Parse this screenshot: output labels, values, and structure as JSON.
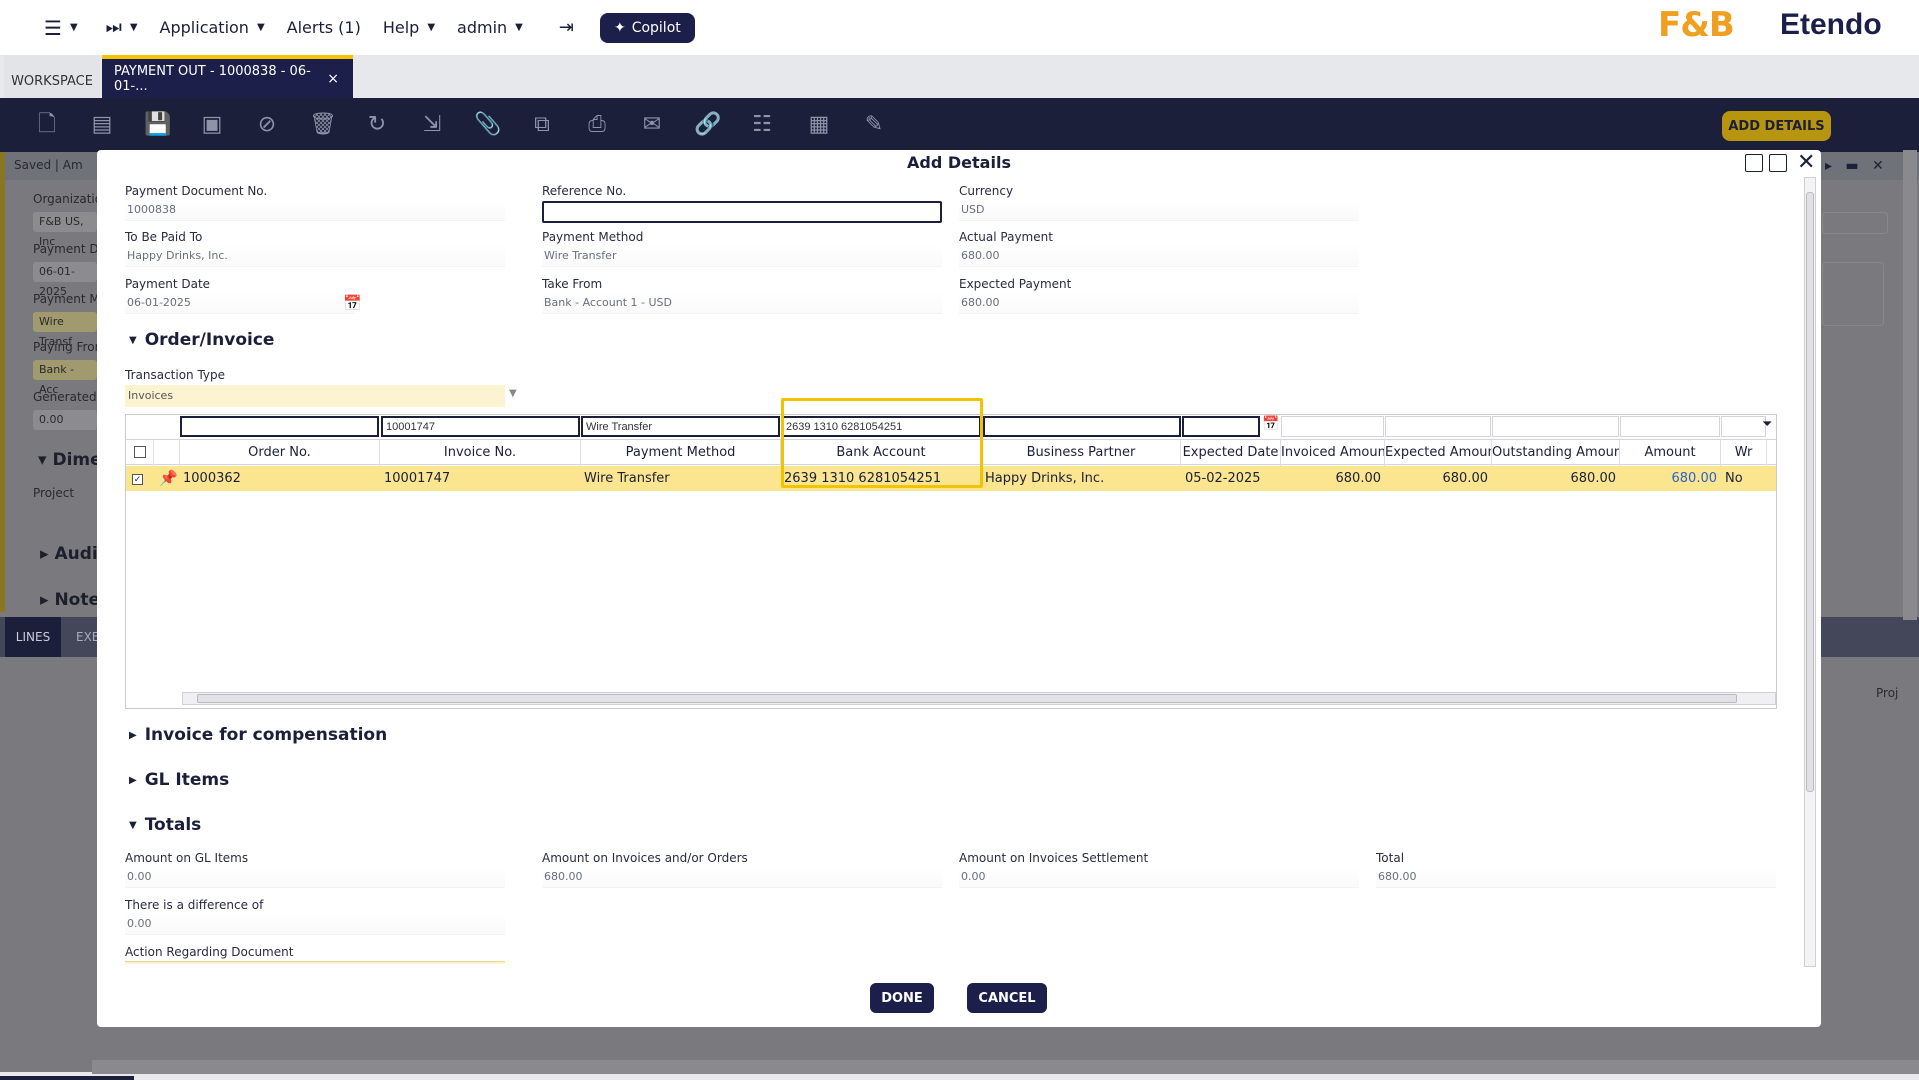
{
  "topnav": {
    "items": [
      "Application",
      "Alerts (1)",
      "Help",
      "admin"
    ],
    "copilot_label": "Copilot",
    "brand_left": "F&B",
    "brand_right": "Etendo"
  },
  "tabs": {
    "workspace": "WORKSPACE",
    "active": "PAYMENT OUT - 1000838 - 06-01-...",
    "close": "×"
  },
  "toolbar": {
    "add_details_label": "ADD DETAILS",
    "icons": [
      "new-document-icon",
      "new-row-icon",
      "save-icon",
      "save-close-icon",
      "cancel-icon",
      "delete-icon",
      "refresh-icon",
      "export-icon",
      "attach-icon",
      "copy-icon",
      "print-icon",
      "email-icon",
      "link-icon",
      "audit-icon",
      "grid-view-icon",
      "notes-icon"
    ]
  },
  "background": {
    "status": "Saved | Am",
    "org_label": "Organizatio",
    "org_value": "F&B US, Inc",
    "paydoc_label": "Payment Do",
    "paydoc_value": "06-01-2025",
    "paymethod_label": "Payment Me",
    "paymethod_value": "Wire Transf",
    "payfrom_label": "Paying From",
    "payfrom_value": "Bank - Acc",
    "generated_label": "Generated",
    "generated_value": "0.00",
    "dimensions": "Dime",
    "project_label": "Project",
    "audit": "Audit",
    "notes": "Notes",
    "lines_tab": "LINES",
    "exe_tab": "EXE",
    "proj_col": "Proj"
  },
  "modal": {
    "title": "Add Details",
    "fields": {
      "payment_doc_label": "Payment Document No.",
      "payment_doc_value": "1000838",
      "reference_label": "Reference No.",
      "reference_value": "",
      "currency_label": "Currency",
      "currency_value": "USD",
      "paid_to_label": "To Be Paid To",
      "paid_to_value": "Happy Drinks, Inc.",
      "payment_method_label": "Payment Method",
      "payment_method_value": "Wire Transfer",
      "actual_payment_label": "Actual Payment",
      "actual_payment_value": "680.00",
      "payment_date_label": "Payment Date",
      "payment_date_value": "06-01-2025",
      "take_from_label": "Take From",
      "take_from_value": "Bank - Account 1 - USD",
      "expected_payment_label": "Expected Payment",
      "expected_payment_value": "680.00"
    },
    "order_invoice_section": "Order/Invoice",
    "transaction_type_label": "Transaction Type",
    "transaction_type_value": "Invoices",
    "grid": {
      "filters": [
        "",
        "10001747",
        "Wire Transfer",
        "2639 1310 6281054251",
        "",
        "",
        "",
        "",
        "",
        "",
        ""
      ],
      "headers": [
        "Order No.",
        "Invoice No.",
        "Payment Method",
        "Bank Account",
        "Business Partner",
        "Expected Date",
        "Invoiced Amount",
        "Expected Amount",
        "Outstanding Amount",
        "Amount",
        "Wr"
      ],
      "rows": [
        {
          "order_no": "1000362",
          "invoice_no": "10001747",
          "payment_method": "Wire Transfer",
          "bank_account": "2639 1310 6281054251",
          "business_partner": "Happy Drinks, Inc.",
          "expected_date": "05-02-2025",
          "invoiced_amount": "680.00",
          "expected_amount": "680.00",
          "outstanding_amount": "680.00",
          "amount": "680.00",
          "wr": "No"
        }
      ]
    },
    "invoice_compensation_section": "Invoice for compensation",
    "gl_items_section": "GL Items",
    "totals_section": "Totals",
    "totals": {
      "gl_items_label": "Amount on GL Items",
      "gl_items_value": "0.00",
      "invoices_orders_label": "Amount on Invoices and/or Orders",
      "invoices_orders_value": "680.00",
      "settlement_label": "Amount on Invoices Settlement",
      "settlement_value": "0.00",
      "total_label": "Total",
      "total_value": "680.00",
      "difference_label": "There is a difference of",
      "difference_value": "0.00",
      "action_label": "Action Regarding Document"
    },
    "done_label": "DONE",
    "cancel_label": "CANCEL"
  },
  "colors": {
    "navy": "#1b1f4a",
    "accent_yellow": "#f0c400",
    "row_highlight": "#fbe68f",
    "link_blue": "#2a62c9"
  }
}
